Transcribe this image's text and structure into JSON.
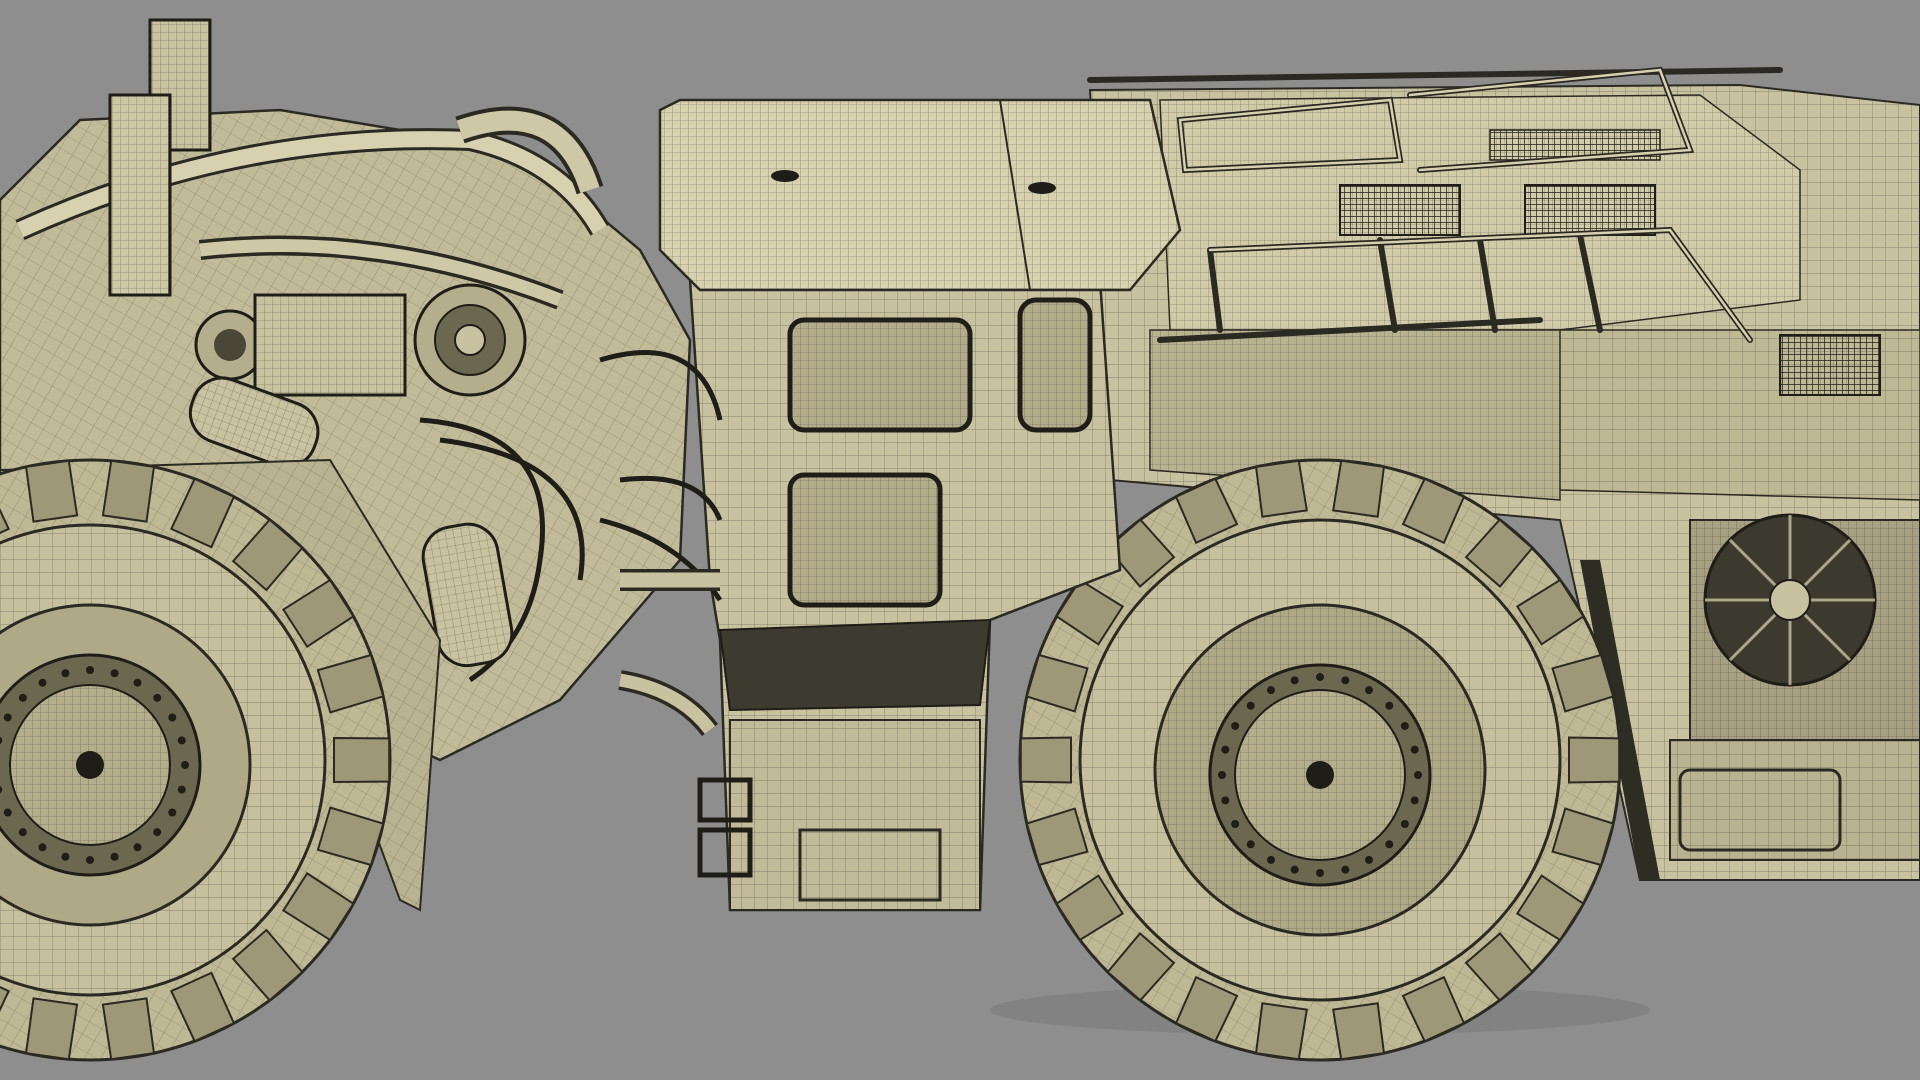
{
  "viewport": {
    "background": "#8e8e8e",
    "subject": "wireframe-render-articulated-mining-loader",
    "colors": {
      "surface": "#c9c2a0",
      "surface_light": "#d8d1b0",
      "surface_dark": "#9e9778",
      "shadow": "#57533f",
      "wire": "#2b2a22",
      "ground_shadow": "#7a7a7a"
    }
  }
}
